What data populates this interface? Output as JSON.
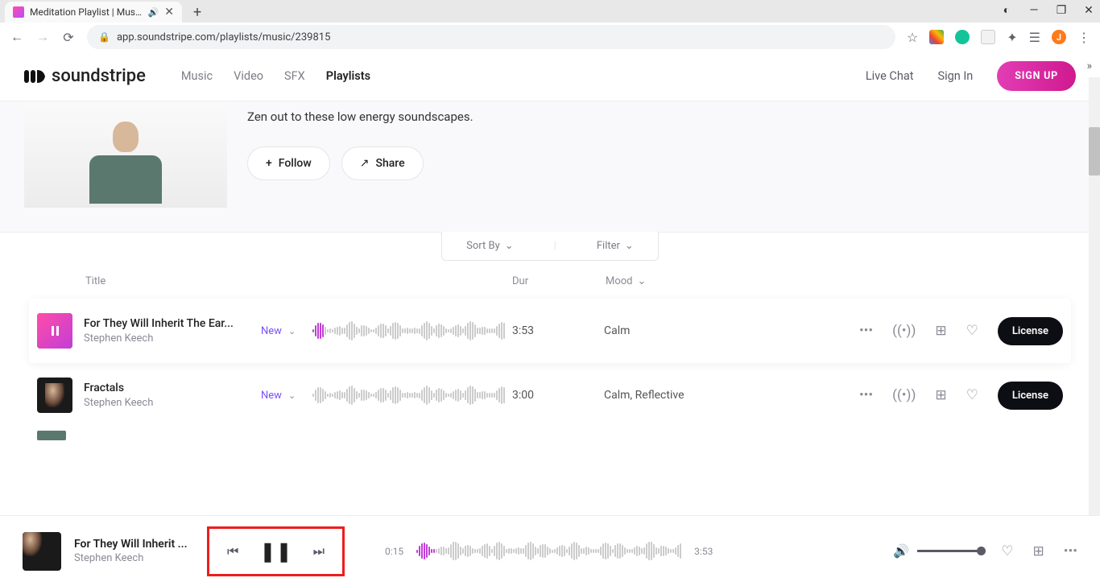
{
  "browser": {
    "tab_title": "Meditation Playlist | Music Li",
    "url": "app.soundstripe.com/playlists/music/239815",
    "avatar_letter": "J"
  },
  "header": {
    "logo_text": "soundstripe",
    "nav": {
      "music": "Music",
      "video": "Video",
      "sfx": "SFX",
      "playlists": "Playlists"
    },
    "live_chat": "Live Chat",
    "sign_in": "Sign In",
    "sign_up": "SIGN UP"
  },
  "hero": {
    "description": "Zen out to these low energy soundscapes.",
    "follow": "Follow",
    "share": "Share"
  },
  "sortbar": {
    "sort_by": "Sort By",
    "filter": "Filter"
  },
  "table_head": {
    "title": "Title",
    "dur": "Dur",
    "mood": "Mood"
  },
  "tracks": [
    {
      "title": "For They Will Inherit The Ear...",
      "artist": "Stephen Keech",
      "new": "New",
      "duration": "3:53",
      "mood": "Calm",
      "license": "License",
      "playing": true
    },
    {
      "title": "Fractals",
      "artist": "Stephen Keech",
      "new": "New",
      "duration": "3:00",
      "mood": "Calm, Reflective",
      "license": "License",
      "playing": false
    }
  ],
  "player": {
    "title": "For They Will Inherit ...",
    "artist": "Stephen Keech",
    "elapsed": "0:15",
    "total": "3:53"
  }
}
